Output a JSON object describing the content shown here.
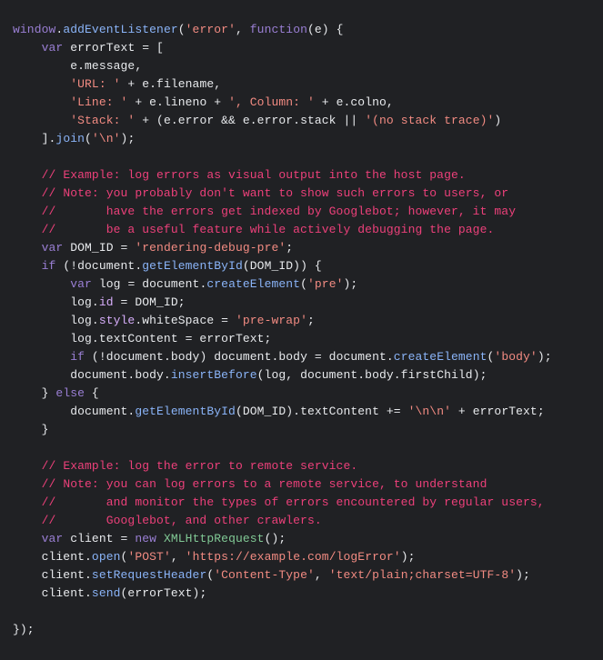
{
  "code": {
    "language": "javascript",
    "lines": [
      [
        {
          "t": "window",
          "c": "tok-keyword"
        },
        {
          "t": ".",
          "c": "tok-punc"
        },
        {
          "t": "addEventListener",
          "c": "tok-func"
        },
        {
          "t": "(",
          "c": "tok-punc"
        },
        {
          "t": "'error'",
          "c": "tok-string"
        },
        {
          "t": ", ",
          "c": "tok-punc"
        },
        {
          "t": "function",
          "c": "tok-keyword"
        },
        {
          "t": "(e) {",
          "c": "tok-punc"
        }
      ],
      [
        {
          "t": "    ",
          "c": "tok-punc"
        },
        {
          "t": "var",
          "c": "tok-keyword"
        },
        {
          "t": " errorText = [",
          "c": "tok-punc"
        }
      ],
      [
        {
          "t": "        e.message,",
          "c": "tok-default"
        }
      ],
      [
        {
          "t": "        ",
          "c": "tok-punc"
        },
        {
          "t": "'URL: '",
          "c": "tok-string"
        },
        {
          "t": " + e.filename,",
          "c": "tok-default"
        }
      ],
      [
        {
          "t": "        ",
          "c": "tok-punc"
        },
        {
          "t": "'Line: '",
          "c": "tok-string"
        },
        {
          "t": " + e.lineno + ",
          "c": "tok-default"
        },
        {
          "t": "', Column: '",
          "c": "tok-string"
        },
        {
          "t": " + e.colno,",
          "c": "tok-default"
        }
      ],
      [
        {
          "t": "        ",
          "c": "tok-punc"
        },
        {
          "t": "'Stack: '",
          "c": "tok-string"
        },
        {
          "t": " + (e.error && e.error.stack || ",
          "c": "tok-default"
        },
        {
          "t": "'(no stack trace)'",
          "c": "tok-string"
        },
        {
          "t": ")",
          "c": "tok-default"
        }
      ],
      [
        {
          "t": "    ].",
          "c": "tok-punc"
        },
        {
          "t": "join",
          "c": "tok-func"
        },
        {
          "t": "(",
          "c": "tok-punc"
        },
        {
          "t": "'\\n'",
          "c": "tok-string"
        },
        {
          "t": ");",
          "c": "tok-punc"
        }
      ],
      [
        {
          "t": "",
          "c": "tok-punc"
        }
      ],
      [
        {
          "t": "    ",
          "c": "tok-punc"
        },
        {
          "t": "// Example: log errors as visual output into the host page.",
          "c": "tok-comment"
        }
      ],
      [
        {
          "t": "    ",
          "c": "tok-punc"
        },
        {
          "t": "// Note: you probably don't want to show such errors to users, or",
          "c": "tok-comment"
        }
      ],
      [
        {
          "t": "    ",
          "c": "tok-punc"
        },
        {
          "t": "//       have the errors get indexed by Googlebot; however, it may",
          "c": "tok-comment"
        }
      ],
      [
        {
          "t": "    ",
          "c": "tok-punc"
        },
        {
          "t": "//       be a useful feature while actively debugging the page.",
          "c": "tok-comment"
        }
      ],
      [
        {
          "t": "    ",
          "c": "tok-punc"
        },
        {
          "t": "var",
          "c": "tok-keyword"
        },
        {
          "t": " DOM_ID = ",
          "c": "tok-default"
        },
        {
          "t": "'rendering-debug-pre'",
          "c": "tok-string"
        },
        {
          "t": ";",
          "c": "tok-punc"
        }
      ],
      [
        {
          "t": "    ",
          "c": "tok-punc"
        },
        {
          "t": "if",
          "c": "tok-keyword"
        },
        {
          "t": " (!document.",
          "c": "tok-default"
        },
        {
          "t": "getElementById",
          "c": "tok-func"
        },
        {
          "t": "(DOM_ID)) {",
          "c": "tok-default"
        }
      ],
      [
        {
          "t": "        ",
          "c": "tok-punc"
        },
        {
          "t": "var",
          "c": "tok-keyword"
        },
        {
          "t": " log = document.",
          "c": "tok-default"
        },
        {
          "t": "createElement",
          "c": "tok-func"
        },
        {
          "t": "(",
          "c": "tok-punc"
        },
        {
          "t": "'pre'",
          "c": "tok-string"
        },
        {
          "t": ");",
          "c": "tok-punc"
        }
      ],
      [
        {
          "t": "        log.",
          "c": "tok-default"
        },
        {
          "t": "id",
          "c": "tok-prop"
        },
        {
          "t": " = DOM_ID;",
          "c": "tok-default"
        }
      ],
      [
        {
          "t": "        log.",
          "c": "tok-default"
        },
        {
          "t": "style",
          "c": "tok-prop"
        },
        {
          "t": ".whiteSpace = ",
          "c": "tok-default"
        },
        {
          "t": "'pre-wrap'",
          "c": "tok-string"
        },
        {
          "t": ";",
          "c": "tok-punc"
        }
      ],
      [
        {
          "t": "        log.textContent = errorText;",
          "c": "tok-default"
        }
      ],
      [
        {
          "t": "        ",
          "c": "tok-punc"
        },
        {
          "t": "if",
          "c": "tok-keyword"
        },
        {
          "t": " (!document.body) document.body = document.",
          "c": "tok-default"
        },
        {
          "t": "createElement",
          "c": "tok-func"
        },
        {
          "t": "(",
          "c": "tok-punc"
        },
        {
          "t": "'body'",
          "c": "tok-string"
        },
        {
          "t": ");",
          "c": "tok-punc"
        }
      ],
      [
        {
          "t": "        document.body.",
          "c": "tok-default"
        },
        {
          "t": "insertBefore",
          "c": "tok-func"
        },
        {
          "t": "(log, document.body.firstChild);",
          "c": "tok-default"
        }
      ],
      [
        {
          "t": "    } ",
          "c": "tok-punc"
        },
        {
          "t": "else",
          "c": "tok-keyword"
        },
        {
          "t": " {",
          "c": "tok-punc"
        }
      ],
      [
        {
          "t": "        document.",
          "c": "tok-default"
        },
        {
          "t": "getElementById",
          "c": "tok-func"
        },
        {
          "t": "(DOM_ID).textContent += ",
          "c": "tok-default"
        },
        {
          "t": "'\\n\\n'",
          "c": "tok-string"
        },
        {
          "t": " + errorText;",
          "c": "tok-default"
        }
      ],
      [
        {
          "t": "    }",
          "c": "tok-punc"
        }
      ],
      [
        {
          "t": "",
          "c": "tok-punc"
        }
      ],
      [
        {
          "t": "    ",
          "c": "tok-punc"
        },
        {
          "t": "// Example: log the error to remote service.",
          "c": "tok-comment"
        }
      ],
      [
        {
          "t": "    ",
          "c": "tok-punc"
        },
        {
          "t": "// Note: you can log errors to a remote service, to understand",
          "c": "tok-comment"
        }
      ],
      [
        {
          "t": "    ",
          "c": "tok-punc"
        },
        {
          "t": "//       and monitor the types of errors encountered by regular users,",
          "c": "tok-comment"
        }
      ],
      [
        {
          "t": "    ",
          "c": "tok-punc"
        },
        {
          "t": "//       Googlebot, and other crawlers.",
          "c": "tok-comment"
        }
      ],
      [
        {
          "t": "    ",
          "c": "tok-punc"
        },
        {
          "t": "var",
          "c": "tok-keyword"
        },
        {
          "t": " client = ",
          "c": "tok-default"
        },
        {
          "t": "new",
          "c": "tok-keyword"
        },
        {
          "t": " ",
          "c": "tok-punc"
        },
        {
          "t": "XMLHttpRequest",
          "c": "tok-class"
        },
        {
          "t": "();",
          "c": "tok-punc"
        }
      ],
      [
        {
          "t": "    client.",
          "c": "tok-default"
        },
        {
          "t": "open",
          "c": "tok-func"
        },
        {
          "t": "(",
          "c": "tok-punc"
        },
        {
          "t": "'POST'",
          "c": "tok-string"
        },
        {
          "t": ", ",
          "c": "tok-punc"
        },
        {
          "t": "'https://example.com/logError'",
          "c": "tok-string"
        },
        {
          "t": ");",
          "c": "tok-punc"
        }
      ],
      [
        {
          "t": "    client.",
          "c": "tok-default"
        },
        {
          "t": "setRequestHeader",
          "c": "tok-func"
        },
        {
          "t": "(",
          "c": "tok-punc"
        },
        {
          "t": "'Content-Type'",
          "c": "tok-string"
        },
        {
          "t": ", ",
          "c": "tok-punc"
        },
        {
          "t": "'text/plain;charset=UTF-8'",
          "c": "tok-string"
        },
        {
          "t": ");",
          "c": "tok-punc"
        }
      ],
      [
        {
          "t": "    client.",
          "c": "tok-default"
        },
        {
          "t": "send",
          "c": "tok-func"
        },
        {
          "t": "(errorText);",
          "c": "tok-default"
        }
      ],
      [
        {
          "t": "",
          "c": "tok-punc"
        }
      ],
      [
        {
          "t": "});",
          "c": "tok-punc"
        }
      ]
    ]
  }
}
